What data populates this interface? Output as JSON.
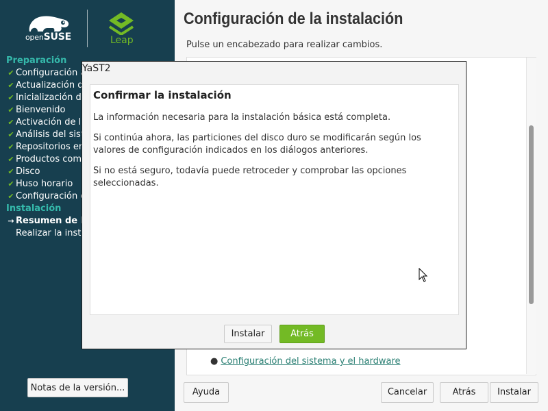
{
  "branding": {
    "opensuse_prefix": "open",
    "opensuse_name": "SUSE",
    "leap_name": "Leap",
    "accent_green": "#73ba25",
    "sidebar_bg": "#173f4f",
    "section_teal": "#35b9ab"
  },
  "sidebar": {
    "section_preparation": "Preparación",
    "section_installation": "Instalación",
    "preparation_steps": [
      {
        "label": "Configuración au",
        "icon": "check-icon"
      },
      {
        "label": "Actualización del",
        "icon": "check-icon"
      },
      {
        "label": "Inicialización de r",
        "icon": "check-icon"
      },
      {
        "label": "Bienvenido",
        "icon": "check-icon"
      },
      {
        "label": "Activación de la r",
        "icon": "check-icon"
      },
      {
        "label": "Análisis del sisten",
        "icon": "check-icon"
      },
      {
        "label": "Repositorios en lí",
        "icon": "check-icon"
      },
      {
        "label": "Productos compl",
        "icon": "check-icon"
      },
      {
        "label": "Disco",
        "icon": "check-icon"
      },
      {
        "label": "Huso horario",
        "icon": "check-icon"
      },
      {
        "label": "Configuración de",
        "icon": "check-icon"
      }
    ],
    "installation_steps": [
      {
        "label": "Resumen de la in",
        "icon": "arrow-right-icon",
        "current": true
      },
      {
        "label": "Realizar la instala",
        "icon": "",
        "current": false
      }
    ],
    "release_notes_button": "Notas de la versión..."
  },
  "main": {
    "title": "Configuración de la instalación",
    "subtitle": "Pulse un encabezado para realizar cambios.",
    "overview_link": "Configuración del sistema y el hardware"
  },
  "footer": {
    "help": "Ayuda",
    "cancel": "Cancelar",
    "back": "Atrás",
    "install": "Instalar"
  },
  "dialog": {
    "window_title": "YaST2",
    "heading": "Confirmar la instalación",
    "paragraph_1": "La información necesaria para la instalación básica está completa.",
    "paragraph_2": "Si continúa ahora, las particiones del disco duro se modificarán según los valores de configuración indicados en los diálogos anteriores.",
    "paragraph_3": "Si no está seguro, todavía puede retroceder y comprobar las opciones seleccionadas.",
    "install_button": "Instalar",
    "back_button": "Atrás"
  }
}
